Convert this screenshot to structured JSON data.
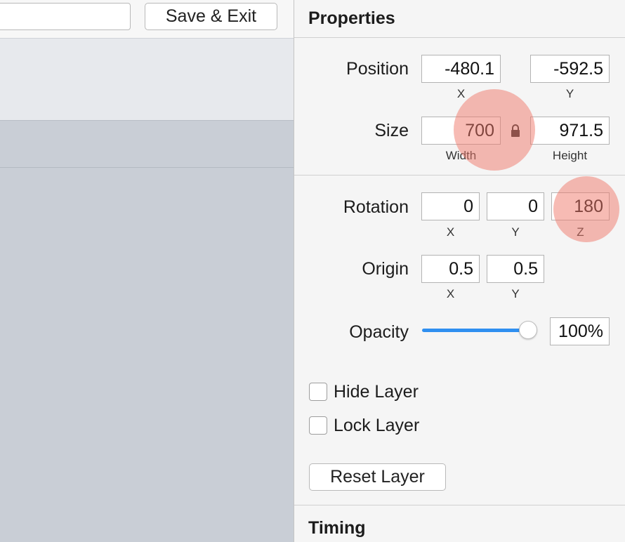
{
  "toolbar": {
    "name_value": "",
    "save_label": "Save & Exit"
  },
  "properties": {
    "title": "Properties",
    "position": {
      "label": "Position",
      "x": "-480.1",
      "y": "-592.5",
      "x_sub": "X",
      "y_sub": "Y"
    },
    "size": {
      "label": "Size",
      "width": "700",
      "height": "971.5",
      "width_sub": "Width",
      "height_sub": "Height",
      "lock_icon": "lock-icon"
    },
    "rotation": {
      "label": "Rotation",
      "x": "0",
      "y": "0",
      "z": "180",
      "x_sub": "X",
      "y_sub": "Y",
      "z_sub": "Z"
    },
    "origin": {
      "label": "Origin",
      "x": "0.5",
      "y": "0.5",
      "x_sub": "X",
      "y_sub": "Y"
    },
    "opacity": {
      "label": "Opacity",
      "value": "100%",
      "slider_fraction": 1.0
    },
    "hide_layer": {
      "label": "Hide Layer",
      "checked": false
    },
    "lock_layer": {
      "label": "Lock Layer",
      "checked": false
    },
    "reset_label": "Reset Layer"
  },
  "timing": {
    "title": "Timing"
  },
  "colors": {
    "accent": "#2f8ff0",
    "highlight": "#f07869"
  }
}
